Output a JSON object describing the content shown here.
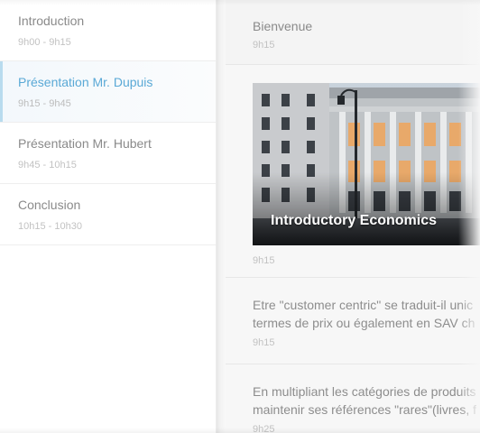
{
  "sidebar": {
    "items": [
      {
        "title": "Introduction",
        "time": "9h00 - 9h15"
      },
      {
        "title": "Présentation Mr. Dupuis",
        "time": "9h15 - 9h45"
      },
      {
        "title": "Présentation Mr. Hubert",
        "time": "9h45 - 10h15"
      },
      {
        "title": "Conclusion",
        "time": "10h15 - 10h30"
      }
    ]
  },
  "feed": {
    "header": {
      "title": "Bienvenue",
      "time": "9h15"
    },
    "photo": {
      "caption": "Introductory Economics",
      "time": "9h15"
    },
    "posts": [
      {
        "line1": "Etre \"customer centric\" se traduit-il unic",
        "line2": "termes de prix ou également en SAV ch",
        "time": "9h15"
      },
      {
        "line1": "En multipliant les catégories de produits",
        "line2": "maintenir ses références \"rares\"(livres, f",
        "time": "9h25"
      }
    ]
  },
  "colors": {
    "accent": "#5aa9d6",
    "accent_bar": "#b8dbee"
  }
}
